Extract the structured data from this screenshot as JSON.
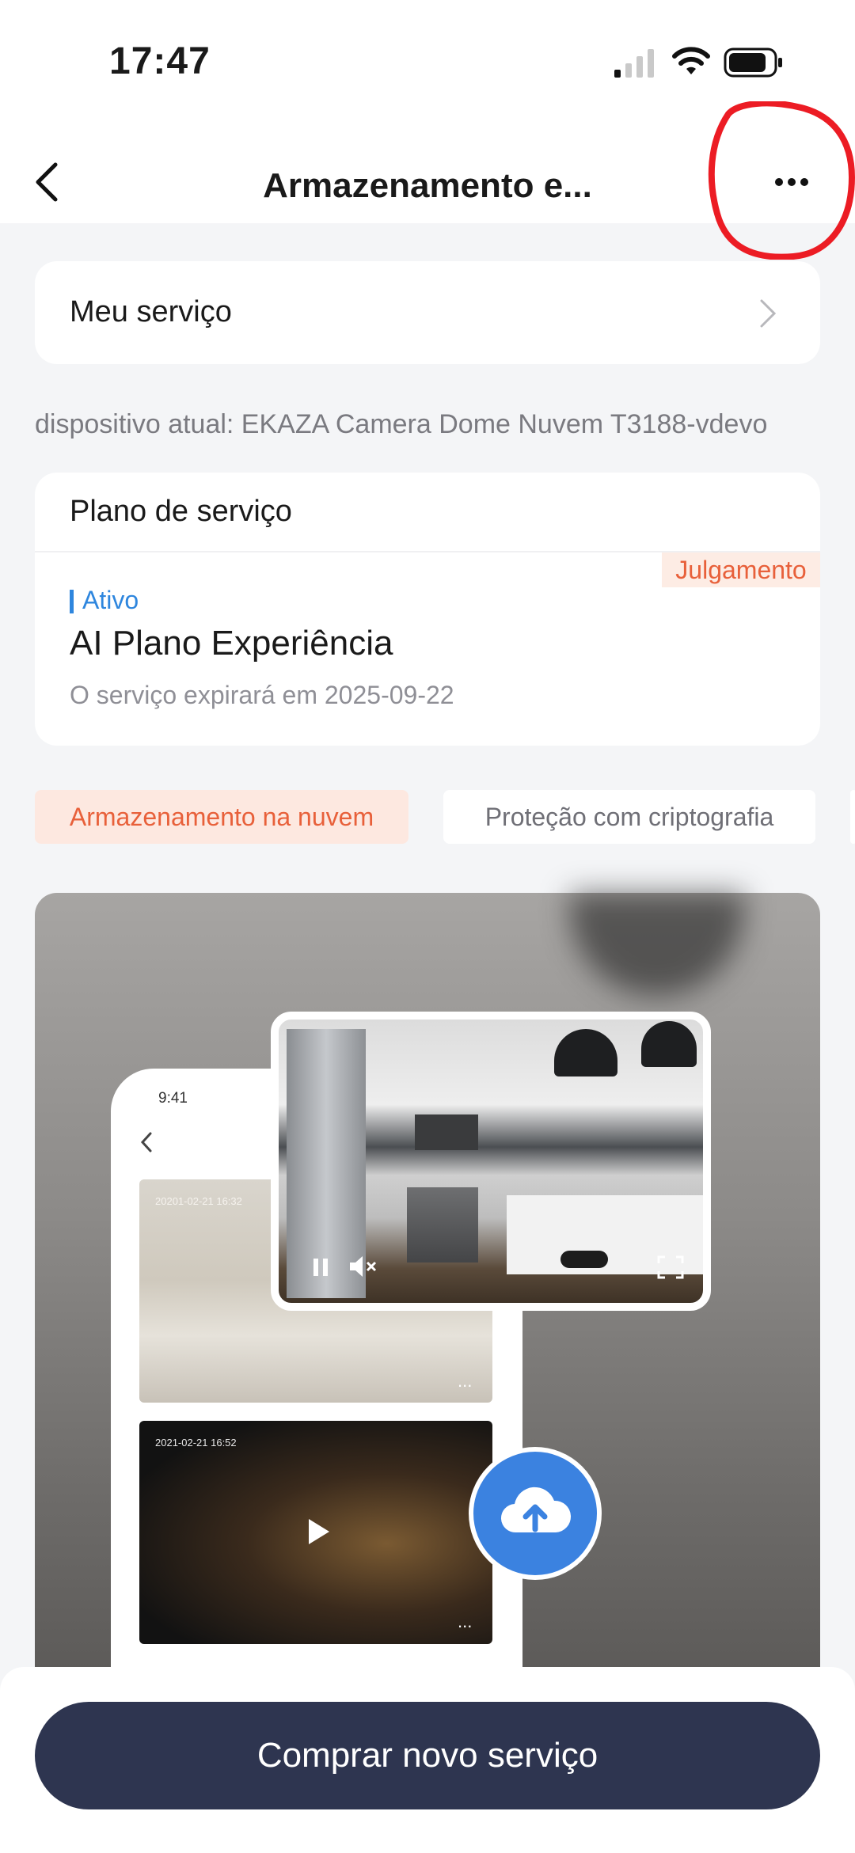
{
  "status_bar": {
    "time": "17:47"
  },
  "header": {
    "title": "Armazenamento e..."
  },
  "my_service": {
    "label": "Meu serviço"
  },
  "device": {
    "text": "dispositivo atual: EKAZA Camera Dome Nuvem T3188-vdevo"
  },
  "plan": {
    "title": "Plano de serviço",
    "badge": "Julgamento",
    "status": "Ativo",
    "name": "AI Plano Experiência",
    "expiry": "O serviço expirará em 2025-09-22"
  },
  "tabs": [
    {
      "label": "Armazenamento na nuvem",
      "active": true
    },
    {
      "label": "Proteção com criptografia",
      "active": false
    }
  ],
  "promo": {
    "phone_time": "9:41",
    "thumb1_timestamp": "20201-02-21 16:32",
    "thumb2_timestamp": "2021-02-21 16:52",
    "more_glyph": "..."
  },
  "buy_button": {
    "label": "Comprar novo serviço"
  },
  "colors": {
    "accent_orange": "#e8603a",
    "accent_blue": "#2e86de",
    "button_dark": "#2e3550",
    "cloud_blue": "#3b82e0"
  }
}
